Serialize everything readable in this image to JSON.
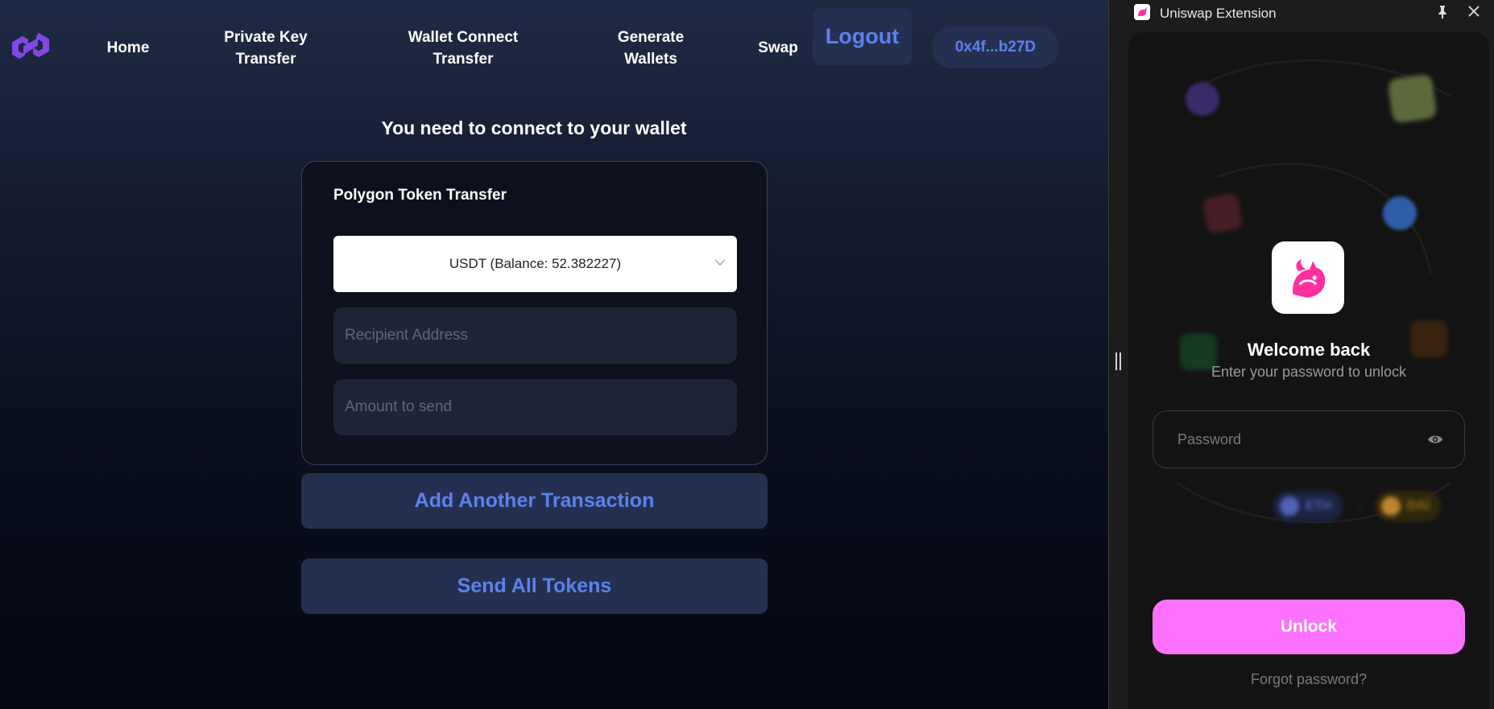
{
  "nav": {
    "home": "Home",
    "private_key_transfer": "Private Key\nTransfer",
    "wallet_connect_transfer": "Wallet Connect\nTransfer",
    "generate_wallets": "Generate\nWallets",
    "swap": "Swap",
    "logout": "Logout",
    "address": "0x4f...b27D"
  },
  "main": {
    "connect_message": "You need to connect to your wallet",
    "card_title": "Polygon Token Transfer",
    "token_select_value": "USDT (Balance: 52.382227)",
    "recipient_placeholder": "Recipient Address",
    "amount_placeholder": "Amount to send",
    "add_transaction_label": "Add Another Transaction",
    "send_all_label": "Send All Tokens"
  },
  "extension": {
    "title": "Uniswap Extension",
    "welcome": "Welcome back",
    "subtitle": "Enter your password to unlock",
    "password_placeholder": "Password",
    "swap_from": "ETH",
    "swap_to": "DAI",
    "unlock_label": "Unlock",
    "forgot_label": "Forgot password?"
  },
  "colors": {
    "accent_blue": "#5b82ee",
    "button_bg": "#24304f",
    "uniswap_pink": "#fc72ff",
    "polygon_purple": "#8247e5"
  },
  "icons": [
    "polygon-logo-icon",
    "chevron-down-icon",
    "uniswap-favicon-icon",
    "pin-icon",
    "close-icon",
    "uniswap-unicorn-icon",
    "eye-icon"
  ]
}
